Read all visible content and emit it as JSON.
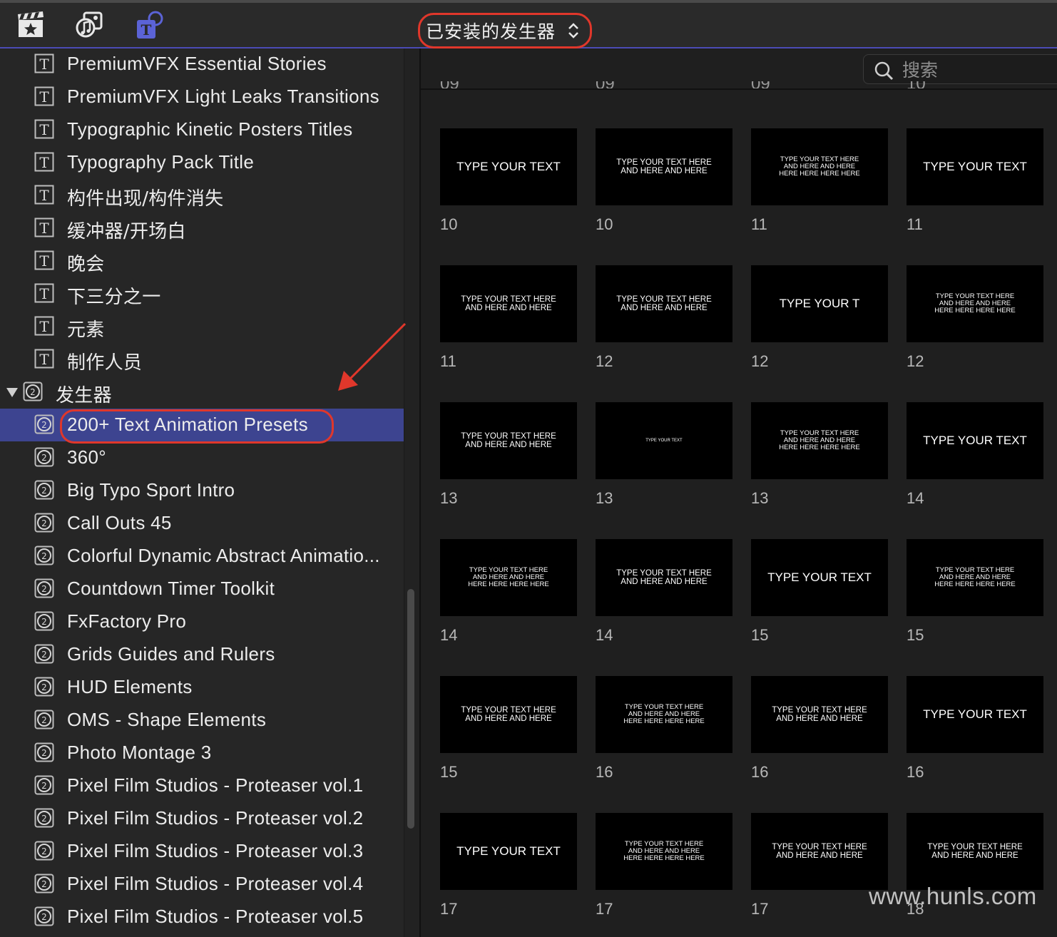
{
  "toolbar": {
    "icons": [
      "clapper-star-icon",
      "music-photo-icon",
      "titles-generators-icon"
    ],
    "browser_select": "已安装的发生器"
  },
  "sidebar": {
    "items": [
      {
        "label": "PremiumVFX Essential Stories",
        "icon": "title-icon"
      },
      {
        "label": "PremiumVFX Light Leaks Transitions",
        "icon": "title-icon"
      },
      {
        "label": "Typographic Kinetic Posters Titles",
        "icon": "title-icon"
      },
      {
        "label": "Typography Pack Title",
        "icon": "title-icon"
      },
      {
        "label": "构件出现/构件消失",
        "icon": "title-icon"
      },
      {
        "label": "缓冲器/开场白",
        "icon": "title-icon"
      },
      {
        "label": "晚会",
        "icon": "title-icon"
      },
      {
        "label": "下三分之一",
        "icon": "title-icon"
      },
      {
        "label": "元素",
        "icon": "title-icon"
      },
      {
        "label": "制作人员",
        "icon": "title-icon"
      }
    ],
    "group": {
      "label": "发生器",
      "icon": "generator-icon",
      "expanded": true
    },
    "generators": [
      {
        "label": "200+ Text Animation Presets",
        "selected": true
      },
      {
        "label": "360°"
      },
      {
        "label": "Big Typo Sport Intro"
      },
      {
        "label": "Call Outs 45"
      },
      {
        "label": "Colorful Dynamic Abstract Animatio..."
      },
      {
        "label": "Countdown Timer Toolkit"
      },
      {
        "label": "FxFactory Pro"
      },
      {
        "label": "Grids Guides and Rulers"
      },
      {
        "label": "HUD Elements"
      },
      {
        "label": "OMS - Shape Elements"
      },
      {
        "label": "Photo Montage 3"
      },
      {
        "label": "Pixel Film Studios - Proteaser vol.1"
      },
      {
        "label": "Pixel Film Studios - Proteaser vol.2"
      },
      {
        "label": "Pixel Film Studios - Proteaser vol.3"
      },
      {
        "label": "Pixel Film Studios - Proteaser vol.4"
      },
      {
        "label": "Pixel Film Studios - Proteaser vol.5"
      }
    ]
  },
  "search": {
    "placeholder": "搜索",
    "value": ""
  },
  "grid": {
    "clipped_labels": [
      "09",
      "09",
      "09",
      "10"
    ],
    "rows": [
      [
        {
          "text": "TYPE YOUR TEXT",
          "size": "big",
          "label": "10"
        },
        {
          "text": "TYPE YOUR TEXT HERE\nAND HERE AND HERE",
          "size": "med",
          "label": "10"
        },
        {
          "text": "TYPE YOUR TEXT HERE\nAND HERE AND HERE\nHERE HERE HERE HERE",
          "size": "small",
          "label": "11"
        },
        {
          "text": "TYPE YOUR TEXT",
          "size": "big",
          "label": "11"
        }
      ],
      [
        {
          "text": "TYPE YOUR TEXT HERE\nAND HERE AND HERE",
          "size": "med",
          "label": "11"
        },
        {
          "text": "TYPE YOUR TEXT HERE\nAND HERE AND HERE",
          "size": "med",
          "label": "12"
        },
        {
          "text": "TYPE YOUR T",
          "size": "big",
          "label": "12"
        },
        {
          "text": "TYPE YOUR TEXT HERE\nAND HERE AND HERE\nHERE HERE HERE HERE",
          "size": "small",
          "label": "12"
        }
      ],
      [
        {
          "text": "TYPE YOUR TEXT HERE\nAND HERE AND HERE",
          "size": "med",
          "label": "13"
        },
        {
          "text": "TYPE YOUR TEXT",
          "size": "tiny",
          "label": "13"
        },
        {
          "text": "TYPE YOUR TEXT HERE\nAND HERE AND HERE\nHERE HERE HERE HERE",
          "size": "small",
          "label": "13"
        },
        {
          "text": "TYPE YOUR TEXT",
          "size": "big",
          "label": "14"
        }
      ],
      [
        {
          "text": "TYPE YOUR TEXT HERE\nAND HERE AND HERE\nHERE HERE HERE HERE",
          "size": "small",
          "label": "14"
        },
        {
          "text": "TYPE YOUR TEXT HERE\nAND HERE AND HERE",
          "size": "med",
          "label": "14"
        },
        {
          "text": "TYPE YOUR TEXT",
          "size": "big",
          "label": "15"
        },
        {
          "text": "TYPE YOUR TEXT HERE\nAND HERE AND HERE\nHERE HERE HERE HERE",
          "size": "small",
          "label": "15"
        }
      ],
      [
        {
          "text": "TYPE YOUR TEXT HERE\nAND HERE AND HERE",
          "size": "med",
          "label": "15"
        },
        {
          "text": "TYPE YOUR TEXT HERE\nAND HERE AND HERE\nHERE HERE HERE HERE",
          "size": "small",
          "label": "16"
        },
        {
          "text": "TYPE YOUR TEXT HERE\nAND HERE AND HERE",
          "size": "med",
          "label": "16"
        },
        {
          "text": "TYPE YOUR TEXT",
          "size": "big",
          "label": "16"
        }
      ],
      [
        {
          "text": "TYPE YOUR TEXT",
          "size": "big",
          "label": "17"
        },
        {
          "text": "TYPE YOUR TEXT HERE\nAND HERE AND HERE\nHERE HERE HERE HERE",
          "size": "small",
          "label": "17"
        },
        {
          "text": "TYPE YOUR TEXT HERE\nAND HERE AND HERE",
          "size": "med",
          "label": "17"
        },
        {
          "text": "TYPE YOUR TEXT HERE\nAND HERE AND HERE",
          "size": "med",
          "label": "18"
        }
      ]
    ]
  },
  "watermark": "www.hunls.com",
  "colors": {
    "selection": "#3d4490",
    "highlight_ring": "#e0372b",
    "accent": "#4b4bb5"
  }
}
